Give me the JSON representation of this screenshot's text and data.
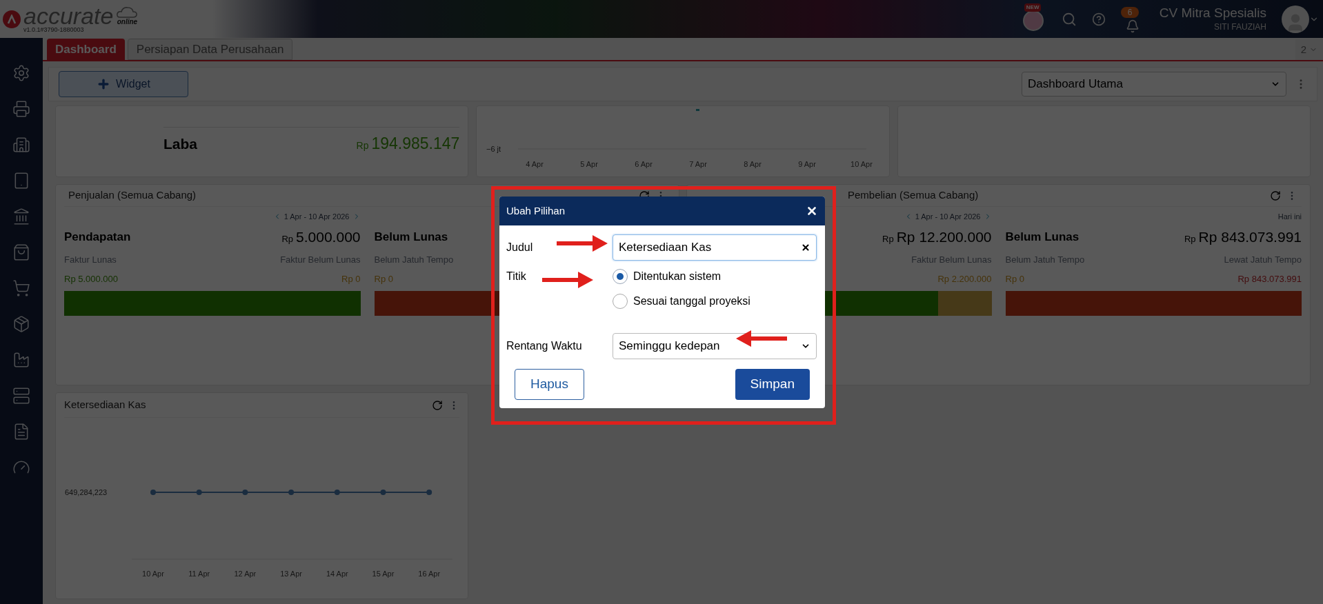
{
  "app": {
    "logo_text": "accurate",
    "logo_sub": "online",
    "version": "v1.0.1#3790-1880003",
    "badge_new": "NEW",
    "notification_count": "6",
    "company": "CV Mitra Spesialis",
    "user": "SITI FAUZIAH"
  },
  "tabs": [
    {
      "label": "Dashboard",
      "selected": true
    },
    {
      "label": "Persiapan Data Perusahaan",
      "selected": false
    }
  ],
  "tab_counter": "2",
  "toolbar": {
    "widget_button": "Widget",
    "dashboard_select": "Dashboard Utama"
  },
  "laba_card": {
    "label": "Laba",
    "currency": "Rp",
    "value": "194.985.147"
  },
  "top_chart": {
    "y_label": "−6 jt",
    "x_labels": [
      "4 Apr",
      "5 Apr",
      "6 Apr",
      "7 Apr",
      "8 Apr",
      "9 Apr",
      "10 Apr"
    ]
  },
  "sales_cards": [
    {
      "title": "Penjualan (Semua Cabang)",
      "blocks": [
        {
          "kind": "revenue",
          "period": "1 Apr - 10 Apr 2026",
          "period_nav": true,
          "title": "Pendapatan",
          "currency": "Rp",
          "value": "5.000.000",
          "left_label": "Faktur Lunas",
          "right_label": "Faktur Belum Lunas",
          "left_amount": "Rp 5.000.000",
          "right_amount": "Rp 0",
          "level": 1
        },
        {
          "kind": "outstanding",
          "title": "Belum Lunas",
          "left_label": "Belum Jatuh Tempo",
          "left_amount": "Rp 0",
          "level": 0
        }
      ]
    },
    {
      "title": "Pembelian (Semua Cabang)",
      "blocks": [
        {
          "kind": "revenue",
          "period": "1 Apr - 10 Apr 2026",
          "period_nav": true,
          "currency": "Rp",
          "value": "Rp 12.200.000",
          "right_label": "Faktur Belum Lunas",
          "right_amount": "Rp 2.200.000",
          "level": 0.82
        },
        {
          "kind": "outstanding",
          "period": "Hari ini",
          "period_nav": false,
          "title": "Belum Lunas",
          "currency": "Rp",
          "value": "Rp 843.073.991",
          "left_label": "Belum Jatuh Tempo",
          "right_label": "Lewat Jatuh Tempo",
          "left_amount": "Rp 0",
          "right_amount": "Rp 843.073.991",
          "level": 0
        }
      ]
    }
  ],
  "cash_card": {
    "title": "Ketersediaan Kas",
    "y_label": "649,284,223",
    "x_labels": [
      "10 Apr",
      "11 Apr",
      "12 Apr",
      "13 Apr",
      "14 Apr",
      "15 Apr",
      "16 Apr"
    ]
  },
  "dialog": {
    "title": "Ubah Pilihan",
    "fields": [
      {
        "kind": "text",
        "label": "Judul",
        "value": "Ketersediaan Kas"
      },
      {
        "kind": "radio",
        "label": "Titik",
        "options": [
          {
            "label": "Ditentukan sistem",
            "selected": true
          },
          {
            "label": "Sesuai tanggal proyeksi",
            "selected": false
          }
        ]
      },
      {
        "kind": "select",
        "label": "Rentang Waktu",
        "value": "Seminggu kedepan"
      }
    ],
    "buttons": [
      {
        "kind": "secondary",
        "label": "Hapus"
      },
      {
        "kind": "primary",
        "label": "Simpan"
      }
    ]
  }
}
